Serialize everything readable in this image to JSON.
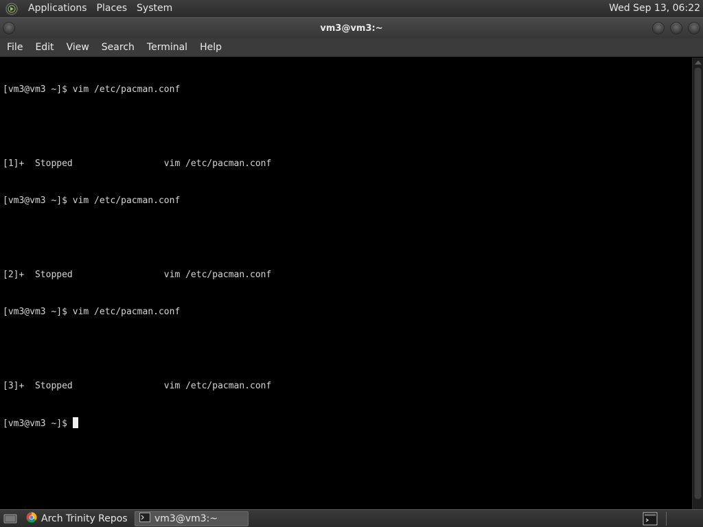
{
  "top_panel": {
    "menus": [
      "Applications",
      "Places",
      "System"
    ],
    "clock": "Wed Sep 13, 06:22",
    "logo_icon": "tde-logo-icon"
  },
  "window": {
    "title": "vm3@vm3:~",
    "menu": [
      "File",
      "Edit",
      "View",
      "Search",
      "Terminal",
      "Help"
    ]
  },
  "terminal": {
    "lines": [
      "[vm3@vm3 ~]$ vim /etc/pacman.conf",
      "",
      "[1]+  Stopped                 vim /etc/pacman.conf",
      "[vm3@vm3 ~]$ vim /etc/pacman.conf",
      "",
      "[2]+  Stopped                 vim /etc/pacman.conf",
      "[vm3@vm3 ~]$ vim /etc/pacman.conf",
      "",
      "[3]+  Stopped                 vim /etc/pacman.conf"
    ],
    "prompt": "[vm3@vm3 ~]$ "
  },
  "taskbar": {
    "tasks": [
      {
        "label": "Arch Trinity Reposit...",
        "icon": "chrome-icon",
        "active": false
      },
      {
        "label": "vm3@vm3:~",
        "icon": "terminal-icon",
        "active": true
      }
    ]
  },
  "colors": {
    "terminal_bg": "#000000",
    "terminal_fg": "#d6d6d6",
    "panel_bg": "#333333"
  }
}
